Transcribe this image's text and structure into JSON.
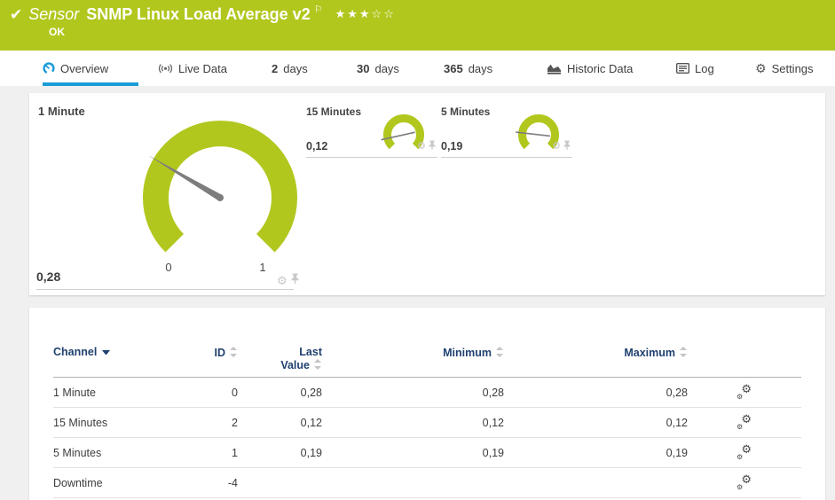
{
  "colors": {
    "status_green": "#b2c71e",
    "accent_blue": "#199cd8",
    "table_header_blue": "#20416f",
    "needle_gray": "#7d7d7d"
  },
  "header": {
    "status_icon": "check-icon",
    "kind_label": "Sensor",
    "title": "SNMP Linux Load Average v2",
    "flag_icon": "flag-icon",
    "rating_stars": "★★★☆☆",
    "rating_filled": 3,
    "rating_total": 5,
    "status_text": "OK"
  },
  "tabs": [
    {
      "label": "Overview",
      "icon": "gauge-icon",
      "active": true
    },
    {
      "label": "Live Data",
      "icon": "live-data-icon"
    },
    {
      "num": "2",
      "label": "days"
    },
    {
      "num": "30",
      "label": "days"
    },
    {
      "num": "365",
      "label": "days"
    },
    {
      "label": "Historic Data",
      "icon": "historic-data-icon"
    },
    {
      "label": "Log",
      "icon": "log-icon"
    },
    {
      "label": "Settings",
      "icon": "settings-icon"
    }
  ],
  "gauges": {
    "scale_sweep_deg": 270,
    "panel_icons": [
      "gear-icon",
      "pin-icon"
    ],
    "primary": {
      "label": "1 Minute",
      "value": "0,28",
      "value_num": 0.28,
      "scale_min": "0",
      "scale_max": "1"
    },
    "secondary": [
      {
        "label": "15 Minutes",
        "value": "0,12",
        "value_num": 0.12
      },
      {
        "label": "5 Minutes",
        "value": "0,19",
        "value_num": 0.19
      }
    ]
  },
  "channel_table": {
    "header": {
      "channel": "Channel",
      "id": "ID",
      "last_line1": "Last",
      "last_line2": "Value",
      "minimum": "Minimum",
      "maximum": "Maximum"
    },
    "sorted_by": "Channel",
    "row_action_icon": "channel-settings-icon",
    "rows": [
      {
        "channel": "1 Minute",
        "id": "0",
        "last_value": "0,28",
        "minimum": "0,28",
        "maximum": "0,28"
      },
      {
        "channel": "15 Minutes",
        "id": "2",
        "last_value": "0,12",
        "minimum": "0,12",
        "maximum": "0,12"
      },
      {
        "channel": "5 Minutes",
        "id": "1",
        "last_value": "0,19",
        "minimum": "0,19",
        "maximum": "0,19"
      },
      {
        "channel": "Downtime",
        "id": "-4",
        "last_value": "",
        "minimum": "",
        "maximum": ""
      }
    ]
  }
}
